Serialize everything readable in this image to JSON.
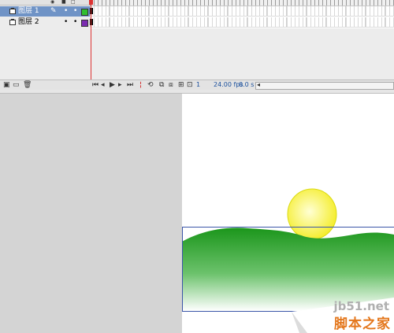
{
  "timeline": {
    "layers": [
      {
        "name": "图层 1",
        "color": "#2fbf2f",
        "selected": true
      },
      {
        "name": "图层 2",
        "color": "#7a2bb0",
        "selected": false
      }
    ],
    "frame_number": "1",
    "fps": "24.00 fps",
    "time": "0.0 s",
    "colors": {
      "selected_row": "#6f93c6",
      "playhead": "#dd3333"
    }
  },
  "stage": {
    "sun": {
      "fill_inner": "#ffffd0",
      "fill_outer": "#f5ef2a"
    },
    "hill": {
      "top_color": "#1c9a1c",
      "bottom_color": "#ffffff"
    },
    "selection_color": "#3a55a8"
  },
  "watermark": {
    "url": "jb51.net",
    "title": "脚本之家"
  }
}
